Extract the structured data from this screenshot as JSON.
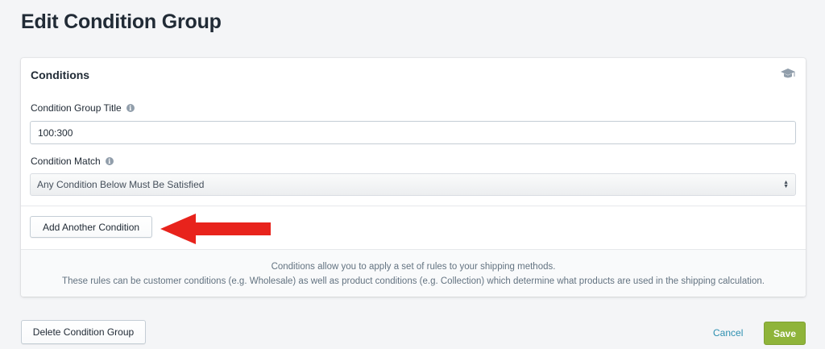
{
  "page": {
    "title": "Edit Condition Group"
  },
  "card": {
    "title": "Conditions",
    "title_icon": "graduation-cap-icon",
    "group_title_label": "Condition Group Title",
    "group_title_value": "100:300",
    "match_label": "Condition Match",
    "match_selected": "Any Condition Below Must Be Satisfied",
    "add_condition_label": "Add Another Condition",
    "help_line_1": "Conditions allow you to apply a set of rules to your shipping methods.",
    "help_line_2": "These rules can be customer conditions (e.g. Wholesale) as well as product conditions (e.g. Collection) which determine what products are used in the shipping calculation."
  },
  "footer": {
    "delete_label": "Delete Condition Group",
    "cancel_label": "Cancel",
    "save_label": "Save"
  },
  "colors": {
    "save": "#8fb43a",
    "cancel_link": "#2d8fb0",
    "arrow": "#e8231c"
  }
}
